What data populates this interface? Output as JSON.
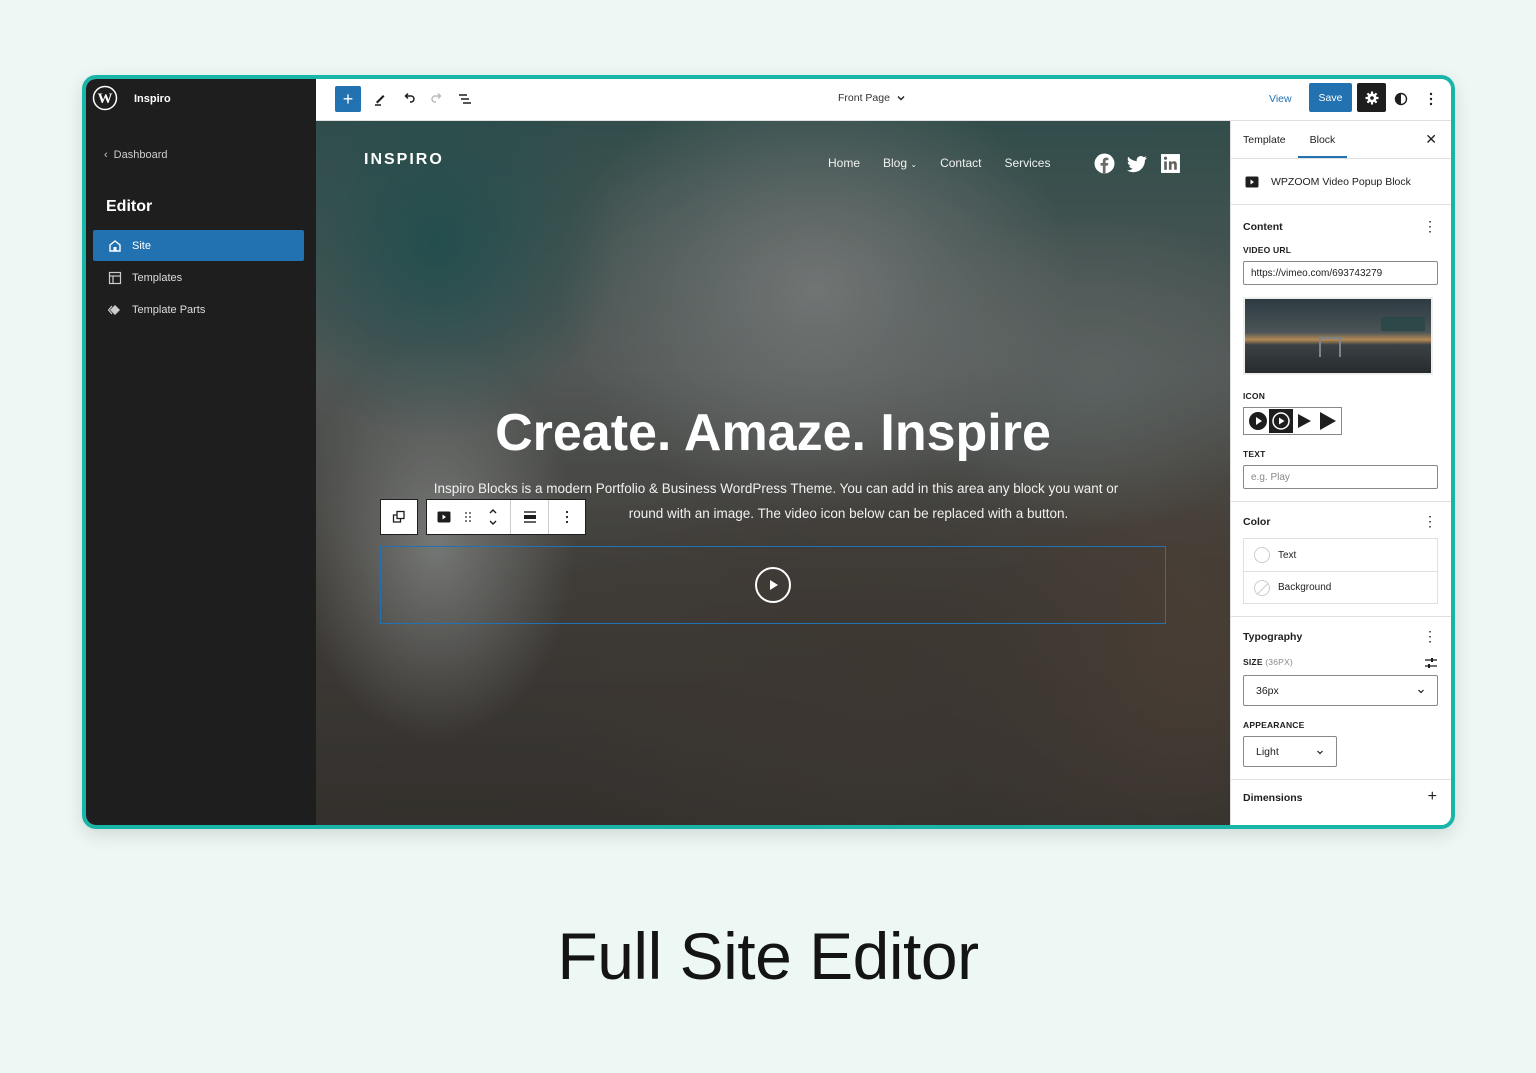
{
  "app": {
    "site_name": "Inspiro",
    "frame_accent": "#18b5a8",
    "accent": "#2271b1"
  },
  "sidebar": {
    "back_label": "Dashboard",
    "section_title": "Editor",
    "items": [
      {
        "label": "Site",
        "icon": "home-icon",
        "active": true
      },
      {
        "label": "Templates",
        "icon": "layout-icon",
        "active": false
      },
      {
        "label": "Template Parts",
        "icon": "symbol-icon",
        "active": false
      }
    ]
  },
  "topbar": {
    "document_title": "Front Page",
    "view_label": "View",
    "save_label": "Save"
  },
  "site": {
    "logo": "INSPIRO",
    "nav": [
      "Home",
      "Blog",
      "Contact",
      "Services"
    ],
    "social": [
      "facebook-icon",
      "twitter-icon",
      "linkedin-icon"
    ],
    "hero_title": "Create. Amaze. Inspire",
    "hero_text": "Inspiro Blocks is a modern Portfolio & Business WordPress Theme. You can add in this area any block you want or ...round with an image. The video icon below can be replaced with a button.",
    "hero_text_line1": "Inspiro Blocks is a modern Portfolio & Business WordPress Theme. You can add in this area any block you want or",
    "hero_text_line2": "round with an image. The video icon below can be replaced with a button."
  },
  "inspector": {
    "tabs": [
      "Template",
      "Block"
    ],
    "active_tab": "Block",
    "block_name": "WPZOOM Video Popup Block",
    "content": {
      "title": "Content",
      "video_url_label": "VIDEO URL",
      "video_url_value": "https://vimeo.com/693743279",
      "icon_label": "ICON",
      "text_label": "TEXT",
      "text_placeholder": "e.g. Play"
    },
    "color": {
      "title": "Color",
      "items": [
        "Text",
        "Background"
      ]
    },
    "typography": {
      "title": "Typography",
      "size_label": "SIZE",
      "size_hint": "(36PX)",
      "size_value": "36px",
      "appearance_label": "APPEARANCE",
      "appearance_value": "Light"
    },
    "dimensions": {
      "title": "Dimensions"
    }
  },
  "caption": "Full Site Editor"
}
